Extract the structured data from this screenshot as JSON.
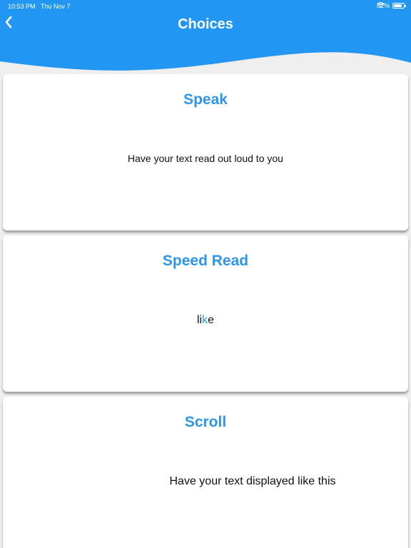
{
  "status_bar": {
    "time": "10:53 PM",
    "date": "Thu Nov 7",
    "battery": "82%",
    "battery_level": 0.82
  },
  "header": {
    "title": "Choices",
    "back_icon": "chevron-left-icon",
    "color": "#2196f3"
  },
  "cards": [
    {
      "title": "Speak",
      "description": "Have your text read out loud to you"
    },
    {
      "title": "Speed Read",
      "word_before": "li",
      "word_focus": "k",
      "word_after": "e"
    },
    {
      "title": "Scroll",
      "description": "Have your text displayed like this"
    }
  ],
  "colors": {
    "accent": "#2d96ea",
    "background": "#efefef",
    "card": "#ffffff"
  }
}
